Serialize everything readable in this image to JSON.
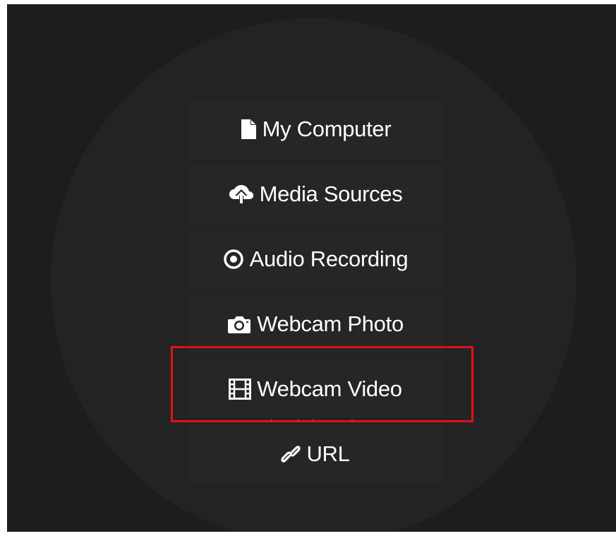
{
  "panel": {
    "title": "",
    "background": "#1d1d1d",
    "button_background": "#262626",
    "highlight_color": "#e3101a"
  },
  "sources": [
    {
      "label": "My Computer",
      "icon": "file-icon"
    },
    {
      "label": "Media Sources",
      "icon": "cloud-upload-icon"
    },
    {
      "label": "Audio Recording",
      "icon": "record-icon"
    },
    {
      "label": "Webcam Photo",
      "icon": "camera-icon"
    },
    {
      "label": "Webcam Video",
      "icon": "film-icon",
      "highlighted": true
    },
    {
      "label": "URL",
      "icon": "link-icon"
    }
  ]
}
